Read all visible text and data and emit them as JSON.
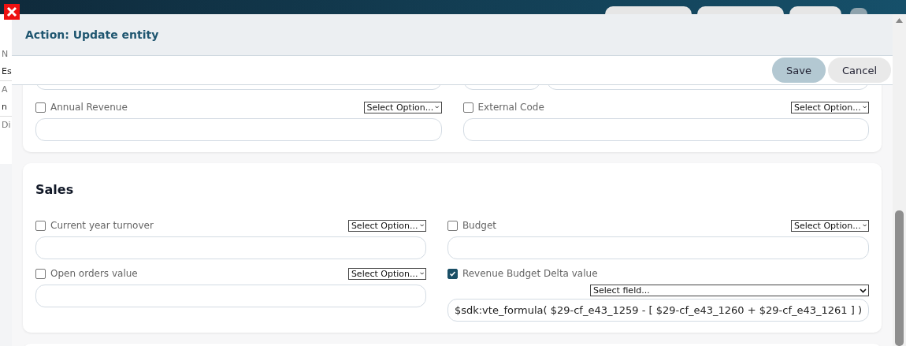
{
  "background_page": {
    "labels": [
      "N",
      "Es",
      "A",
      "n",
      "Di"
    ]
  },
  "dialog": {
    "title": "Action: Update entity",
    "buttons": [
      {
        "label": "Save",
        "kind": "primary"
      },
      {
        "label": "Cancel",
        "kind": "secondary"
      }
    ]
  },
  "sections": [
    {
      "fields": [
        {
          "label": "Annual Revenue",
          "checked": false,
          "kind": "option",
          "select": "Select Option..."
        },
        {
          "label": "External Code",
          "checked": false,
          "kind": "option",
          "select": "Select Option..."
        }
      ]
    },
    {
      "title": "Sales",
      "fields": [
        {
          "label": "Current year turnover",
          "checked": false,
          "kind": "option",
          "select": "Select Option..."
        },
        {
          "label": "Budget",
          "checked": false,
          "kind": "option",
          "select": "Select Option..."
        },
        {
          "label": "Open orders value",
          "checked": false,
          "kind": "option",
          "select": "Select Option..."
        },
        {
          "label": "Revenue Budget Delta value",
          "checked": true,
          "kind": "field",
          "select": "Select field...",
          "value": "$sdk:vte_formula( $29-cf_e43_1259 - [ $29-cf_e43_1260 + $29-cf_e43_1261 ] )"
        }
      ]
    }
  ]
}
